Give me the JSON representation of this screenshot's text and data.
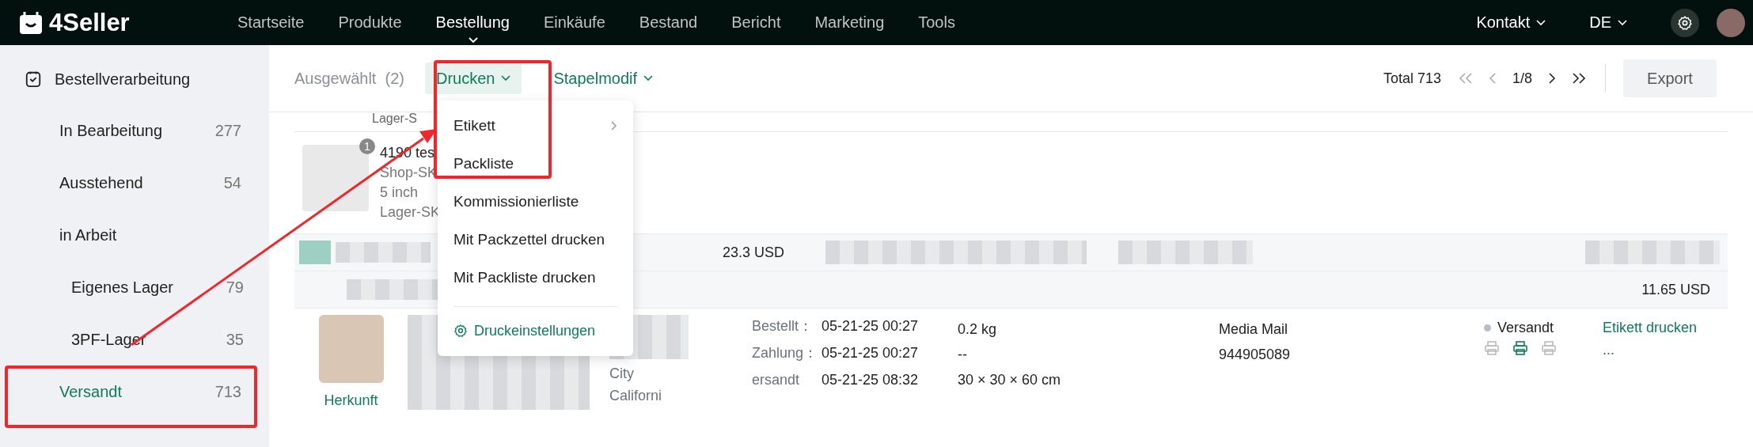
{
  "topbar": {
    "logo": "4Seller",
    "nav": [
      {
        "label": "Startseite",
        "selected": false
      },
      {
        "label": "Produkte",
        "selected": false
      },
      {
        "label": "Bestellung",
        "selected": true
      },
      {
        "label": "Einkäufe",
        "selected": false
      },
      {
        "label": "Bestand",
        "selected": false
      },
      {
        "label": "Bericht",
        "selected": false
      },
      {
        "label": "Marketing",
        "selected": false
      },
      {
        "label": "Tools",
        "selected": false
      }
    ],
    "contact": "Kontakt",
    "language": "DE"
  },
  "sidebar": {
    "title": "Bestellverarbeitung",
    "items": [
      {
        "label": "In Bearbeitung",
        "count": "277",
        "selected": false
      },
      {
        "label": "Ausstehend",
        "count": "54",
        "selected": false
      },
      {
        "label": "in Arbeit",
        "selected": false,
        "children": [
          {
            "label": "Eigenes Lager",
            "count": "79",
            "selected": false
          },
          {
            "label": "3PF-Lager",
            "count": "35",
            "selected": false
          }
        ]
      },
      {
        "label": "Versandt",
        "count": "713",
        "selected": true
      }
    ]
  },
  "toolbar": {
    "selected_label": "Ausgewählt",
    "selected_count": "(2)",
    "print_button": "Drucken",
    "batch_button": "Stapelmodif",
    "total": "Total 713",
    "page": "1/8",
    "export_button": "Export"
  },
  "print_menu": {
    "items": [
      {
        "label": "Etikett",
        "submenu": true
      },
      {
        "label": "Packliste",
        "submenu": false
      },
      {
        "label": "Kommissionierliste",
        "submenu": false
      },
      {
        "label": "Mit Packzettel drucken",
        "submenu": false
      },
      {
        "label": "Mit Packliste drucken",
        "submenu": false
      }
    ],
    "settings": "Druckeinstellungen"
  },
  "order": {
    "partial_line": "Lager-S",
    "product": {
      "badge": "1",
      "title": "4190 tes",
      "lines": [
        "Shop-SK",
        "5 inch",
        "Lager-SK"
      ]
    },
    "summary_rows": [
      {
        "amount": "23.3 USD"
      },
      {
        "amount": "11.65 USD"
      }
    ],
    "detail": {
      "link": "Herkunft",
      "address": [
        "City",
        "Californi"
      ],
      "dates": [
        {
          "label": "Bestellt：",
          "value": "05-21-25 00:27"
        },
        {
          "label": "Zahlung：",
          "value": "05-21-25 00:27"
        },
        {
          "label": "ersandt",
          "value": "05-21-25 08:32"
        }
      ],
      "package": [
        "0.2 kg",
        "--",
        "30 × 30 × 60 cm"
      ],
      "shipping": [
        "Media Mail",
        "944905089"
      ],
      "status": {
        "label": "Versandt",
        "color": "#b8bcc4"
      },
      "print_icons": [
        {
          "selected": false
        },
        {
          "selected": true
        },
        {
          "selected": false
        }
      ],
      "actions": [
        "Etikett drucken",
        "..."
      ]
    }
  }
}
